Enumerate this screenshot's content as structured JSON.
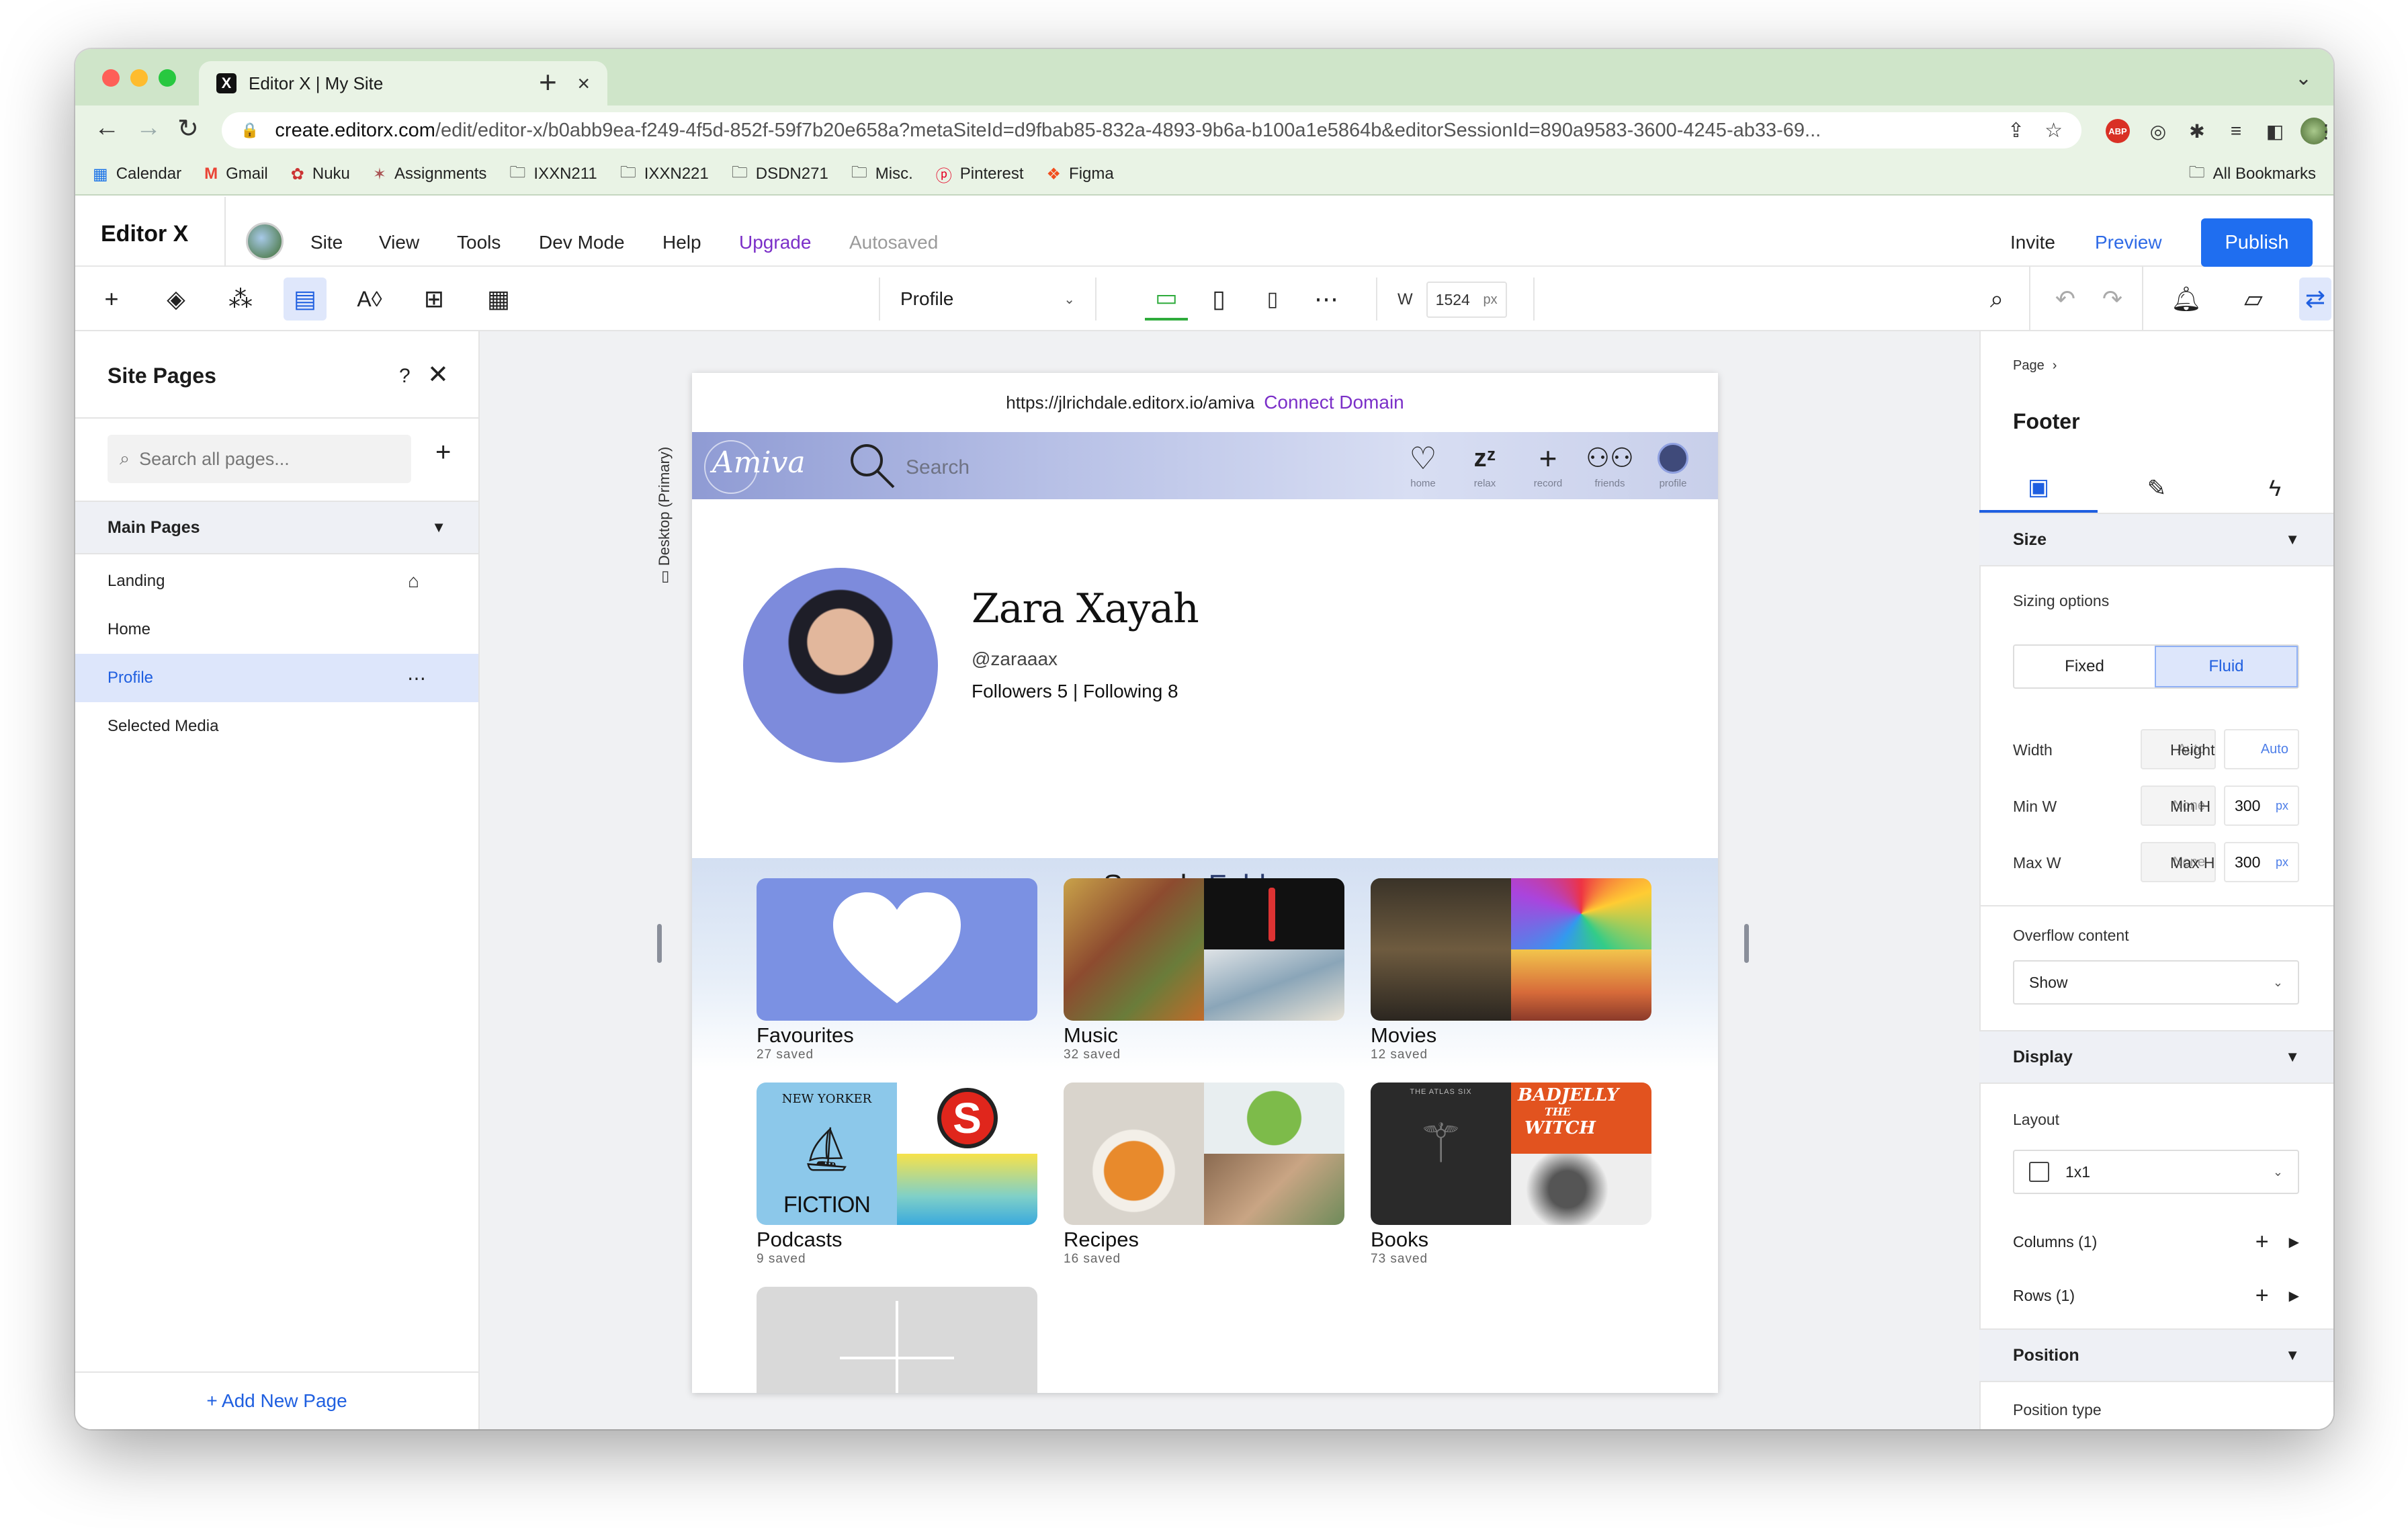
{
  "browser": {
    "tab_title": "Editor X | My Site",
    "url_host": "create.editorx.com",
    "url_path": "/edit/editor-x/b0abb9ea-f249-4f5d-852f-59f7b20e658a?metaSiteId=d9fbab85-832a-4893-9b6a-b100a1e5864b&editorSessionId=890a9583-3600-4245-ab33-69...",
    "bookmarks": [
      "Calendar",
      "Gmail",
      "Nuku",
      "Assignments",
      "IXXN211",
      "IXXN221",
      "DSDN271",
      "Misc.",
      "Pinterest",
      "Figma"
    ],
    "all_bookmarks": "All Bookmarks",
    "colors": {
      "frame": "#cfe5c9",
      "bar": "#e9f3e5"
    }
  },
  "editor": {
    "logo": "Editor X",
    "menu": [
      "Site",
      "View",
      "Tools",
      "Dev Mode",
      "Help"
    ],
    "upgrade": "Upgrade",
    "autosaved": "Autosaved",
    "invite": "Invite",
    "preview": "Preview",
    "publish": "Publish",
    "page_selector": "Profile",
    "width_label": "W",
    "width_value": "1524",
    "width_unit": "px",
    "accent": "#1f6ef0"
  },
  "site_pages": {
    "title": "Site Pages",
    "help": "?",
    "search_placeholder": "Search all pages...",
    "section": "Main Pages",
    "pages": [
      "Landing",
      "Home",
      "Profile",
      "Selected Media"
    ],
    "selected": "Profile",
    "add_page": "+ Add New Page"
  },
  "canvas": {
    "breakpoint_label": "Desktop (Primary)",
    "site_url": "https://jlrichdale.editorx.io/amiva",
    "connect_domain": "Connect Domain"
  },
  "site": {
    "logo": "Amiva",
    "search_placeholder": "Search",
    "nav": [
      {
        "label": "home",
        "icon": "heart-icon"
      },
      {
        "label": "relax",
        "icon": "sleep-zz-icon"
      },
      {
        "label": "record",
        "icon": "plus-icon"
      },
      {
        "label": "friends",
        "icon": "friends-icon"
      },
      {
        "label": "profile",
        "icon": "avatar-icon"
      }
    ],
    "profile": {
      "name": "Zara Xayah",
      "handle": "@zaraaax",
      "follow": "Followers 5 | Following 8"
    },
    "tabs": [
      "Saved",
      "Folders"
    ],
    "active_tab": "Folders",
    "folders": [
      {
        "title": "Favourites",
        "count": "27 saved"
      },
      {
        "title": "Music",
        "count": "32 saved"
      },
      {
        "title": "Movies",
        "count": "12 saved"
      },
      {
        "title": "Podcasts",
        "count": "9 saved"
      },
      {
        "title": "Recipes",
        "count": "16 saved"
      },
      {
        "title": "Books",
        "count": "73 saved"
      }
    ],
    "podcast_art": {
      "magazine": "NEW YORKER",
      "word": "FICTION",
      "letter": "S"
    },
    "book_art": {
      "title1": "BADJELLY",
      "title2": "THE",
      "title3": "WITCH",
      "small": "THE ATLAS SIX"
    }
  },
  "inspector": {
    "breadcrumb": "Page",
    "title": "Footer",
    "size_section": "Size",
    "sizing_options": "Sizing options",
    "sizing_modes": [
      "Fixed",
      "Fluid"
    ],
    "sizing_selected": "Fluid",
    "width_label": "Width",
    "width_value": "Auto",
    "height_label": "Height",
    "height_value": "Auto",
    "minw_label": "Min W",
    "minw_value": "None",
    "minh_label": "Min H",
    "minh_value": "300",
    "maxw_label": "Max W",
    "maxw_value": "None",
    "maxh_label": "Max H",
    "maxh_value": "300",
    "unit": "px",
    "overflow_label": "Overflow content",
    "overflow_value": "Show",
    "display_section": "Display",
    "layout_label": "Layout",
    "layout_value": "1x1",
    "columns": "Columns (1)",
    "rows": "Rows (1)",
    "position_section": "Position",
    "position_type": "Position type"
  }
}
